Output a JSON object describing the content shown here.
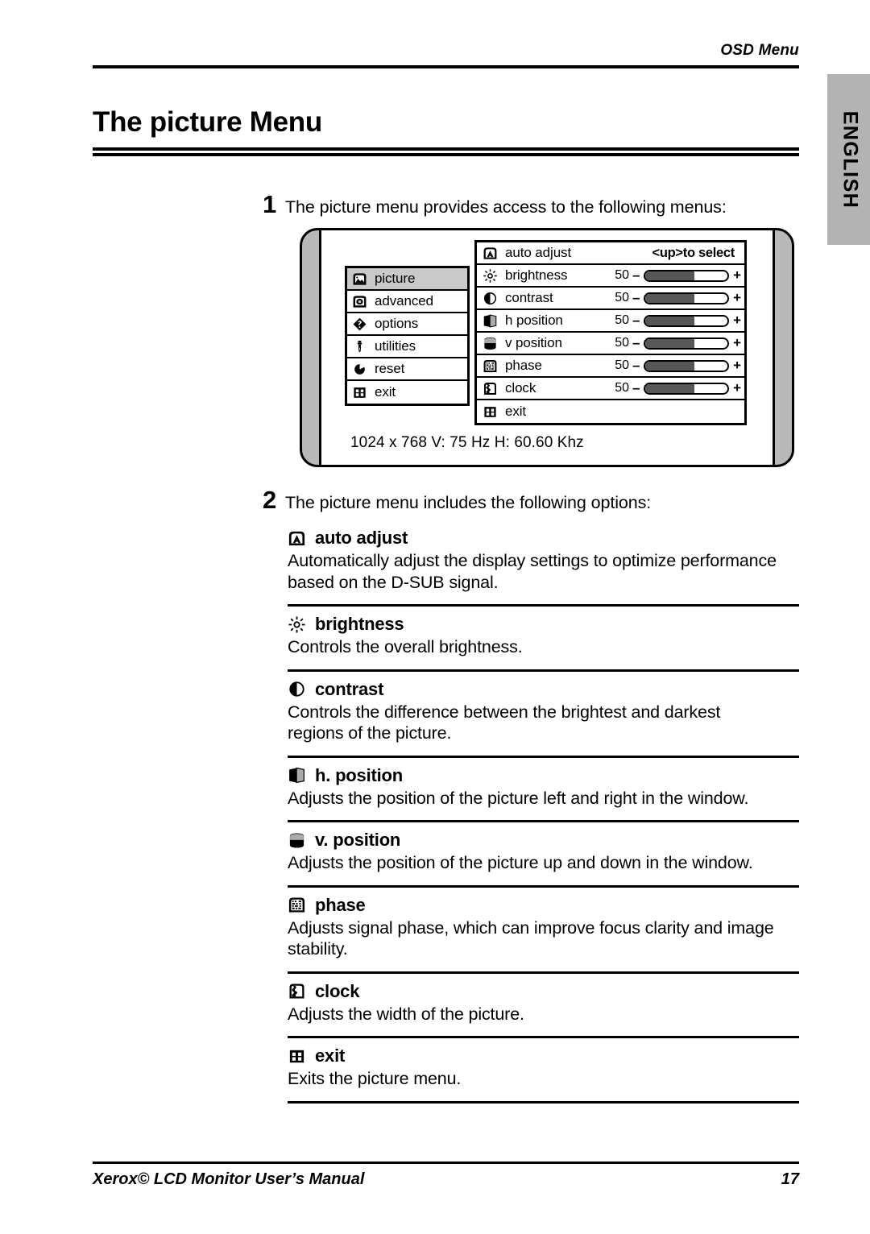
{
  "header": {
    "running_head": "OSD Menu",
    "language_tab": "ENGLISH"
  },
  "title": "The picture Menu",
  "steps": [
    {
      "number": "1",
      "text": "The picture menu provides access to the following menus:"
    },
    {
      "number": "2",
      "text": "The picture menu includes the following options:"
    }
  ],
  "osd": {
    "sidebar": [
      {
        "icon": "picture-icon",
        "label": "picture",
        "selected": true
      },
      {
        "icon": "advanced-icon",
        "label": "advanced",
        "selected": false
      },
      {
        "icon": "options-icon",
        "label": "options",
        "selected": false
      },
      {
        "icon": "utilities-icon",
        "label": "utilities",
        "selected": false
      },
      {
        "icon": "reset-icon",
        "label": "reset",
        "selected": false
      },
      {
        "icon": "exit-icon",
        "label": "exit",
        "selected": false
      }
    ],
    "rows": [
      {
        "icon": "auto-adjust-icon",
        "label": "auto adjust",
        "type": "hint",
        "hint": "<up>to select"
      },
      {
        "icon": "brightness-icon",
        "label": "brightness",
        "type": "slider",
        "value": "50",
        "percent": 60,
        "minus": "–",
        "plus": "+"
      },
      {
        "icon": "contrast-icon",
        "label": "contrast",
        "type": "slider",
        "value": "50",
        "percent": 60,
        "minus": "–",
        "plus": "+"
      },
      {
        "icon": "h-position-icon",
        "label": "h position",
        "type": "slider",
        "value": "50",
        "percent": 60,
        "minus": "–",
        "plus": "+"
      },
      {
        "icon": "v-position-icon",
        "label": "v position",
        "type": "slider",
        "value": "50",
        "percent": 60,
        "minus": "–",
        "plus": "+"
      },
      {
        "icon": "phase-icon",
        "label": "phase",
        "type": "slider",
        "value": "50",
        "percent": 60,
        "minus": "–",
        "plus": "+"
      },
      {
        "icon": "clock-icon",
        "label": "clock",
        "type": "slider",
        "value": "50",
        "percent": 60,
        "minus": "–",
        "plus": "+"
      },
      {
        "icon": "exit-icon",
        "label": "exit",
        "type": "plain"
      }
    ],
    "status": "1024 x 768 V: 75 Hz   H: 60.60 Khz"
  },
  "options": [
    {
      "icon": "auto-adjust-icon",
      "name": "auto adjust",
      "description": "Automatically adjust the display settings to optimize performance based on the D-SUB signal."
    },
    {
      "icon": "brightness-icon",
      "name": "brightness",
      "description": "Controls the overall brightness."
    },
    {
      "icon": "contrast-icon",
      "name": "contrast",
      "description": "Controls the difference between the brightest and darkest regions of the picture."
    },
    {
      "icon": "h-position-icon",
      "name": "h. position",
      "description": "Adjusts  the position of the picture left and right in the window."
    },
    {
      "icon": "v-position-icon",
      "name": "v. position",
      "description": "Adjusts the position of the picture up and down in the window."
    },
    {
      "icon": "phase-icon",
      "name": "phase",
      "description": "Adjusts signal phase, which can improve focus clarity and image stability."
    },
    {
      "icon": "clock-icon",
      "name": "clock",
      "description": "Adjusts the width of the picture."
    },
    {
      "icon": "exit-icon",
      "name": "exit",
      "description": "Exits the picture menu."
    }
  ],
  "footer": {
    "manual_title": "Xerox© LCD Monitor User’s Manual",
    "page_number": "17"
  },
  "colors": {
    "ink": "#000000",
    "paper": "#ffffff",
    "tab_gray": "#b3b3b3",
    "shell_gray": "#b8b8b8",
    "selected_gray": "#c9c9c9",
    "slider_fill": "#575757"
  }
}
